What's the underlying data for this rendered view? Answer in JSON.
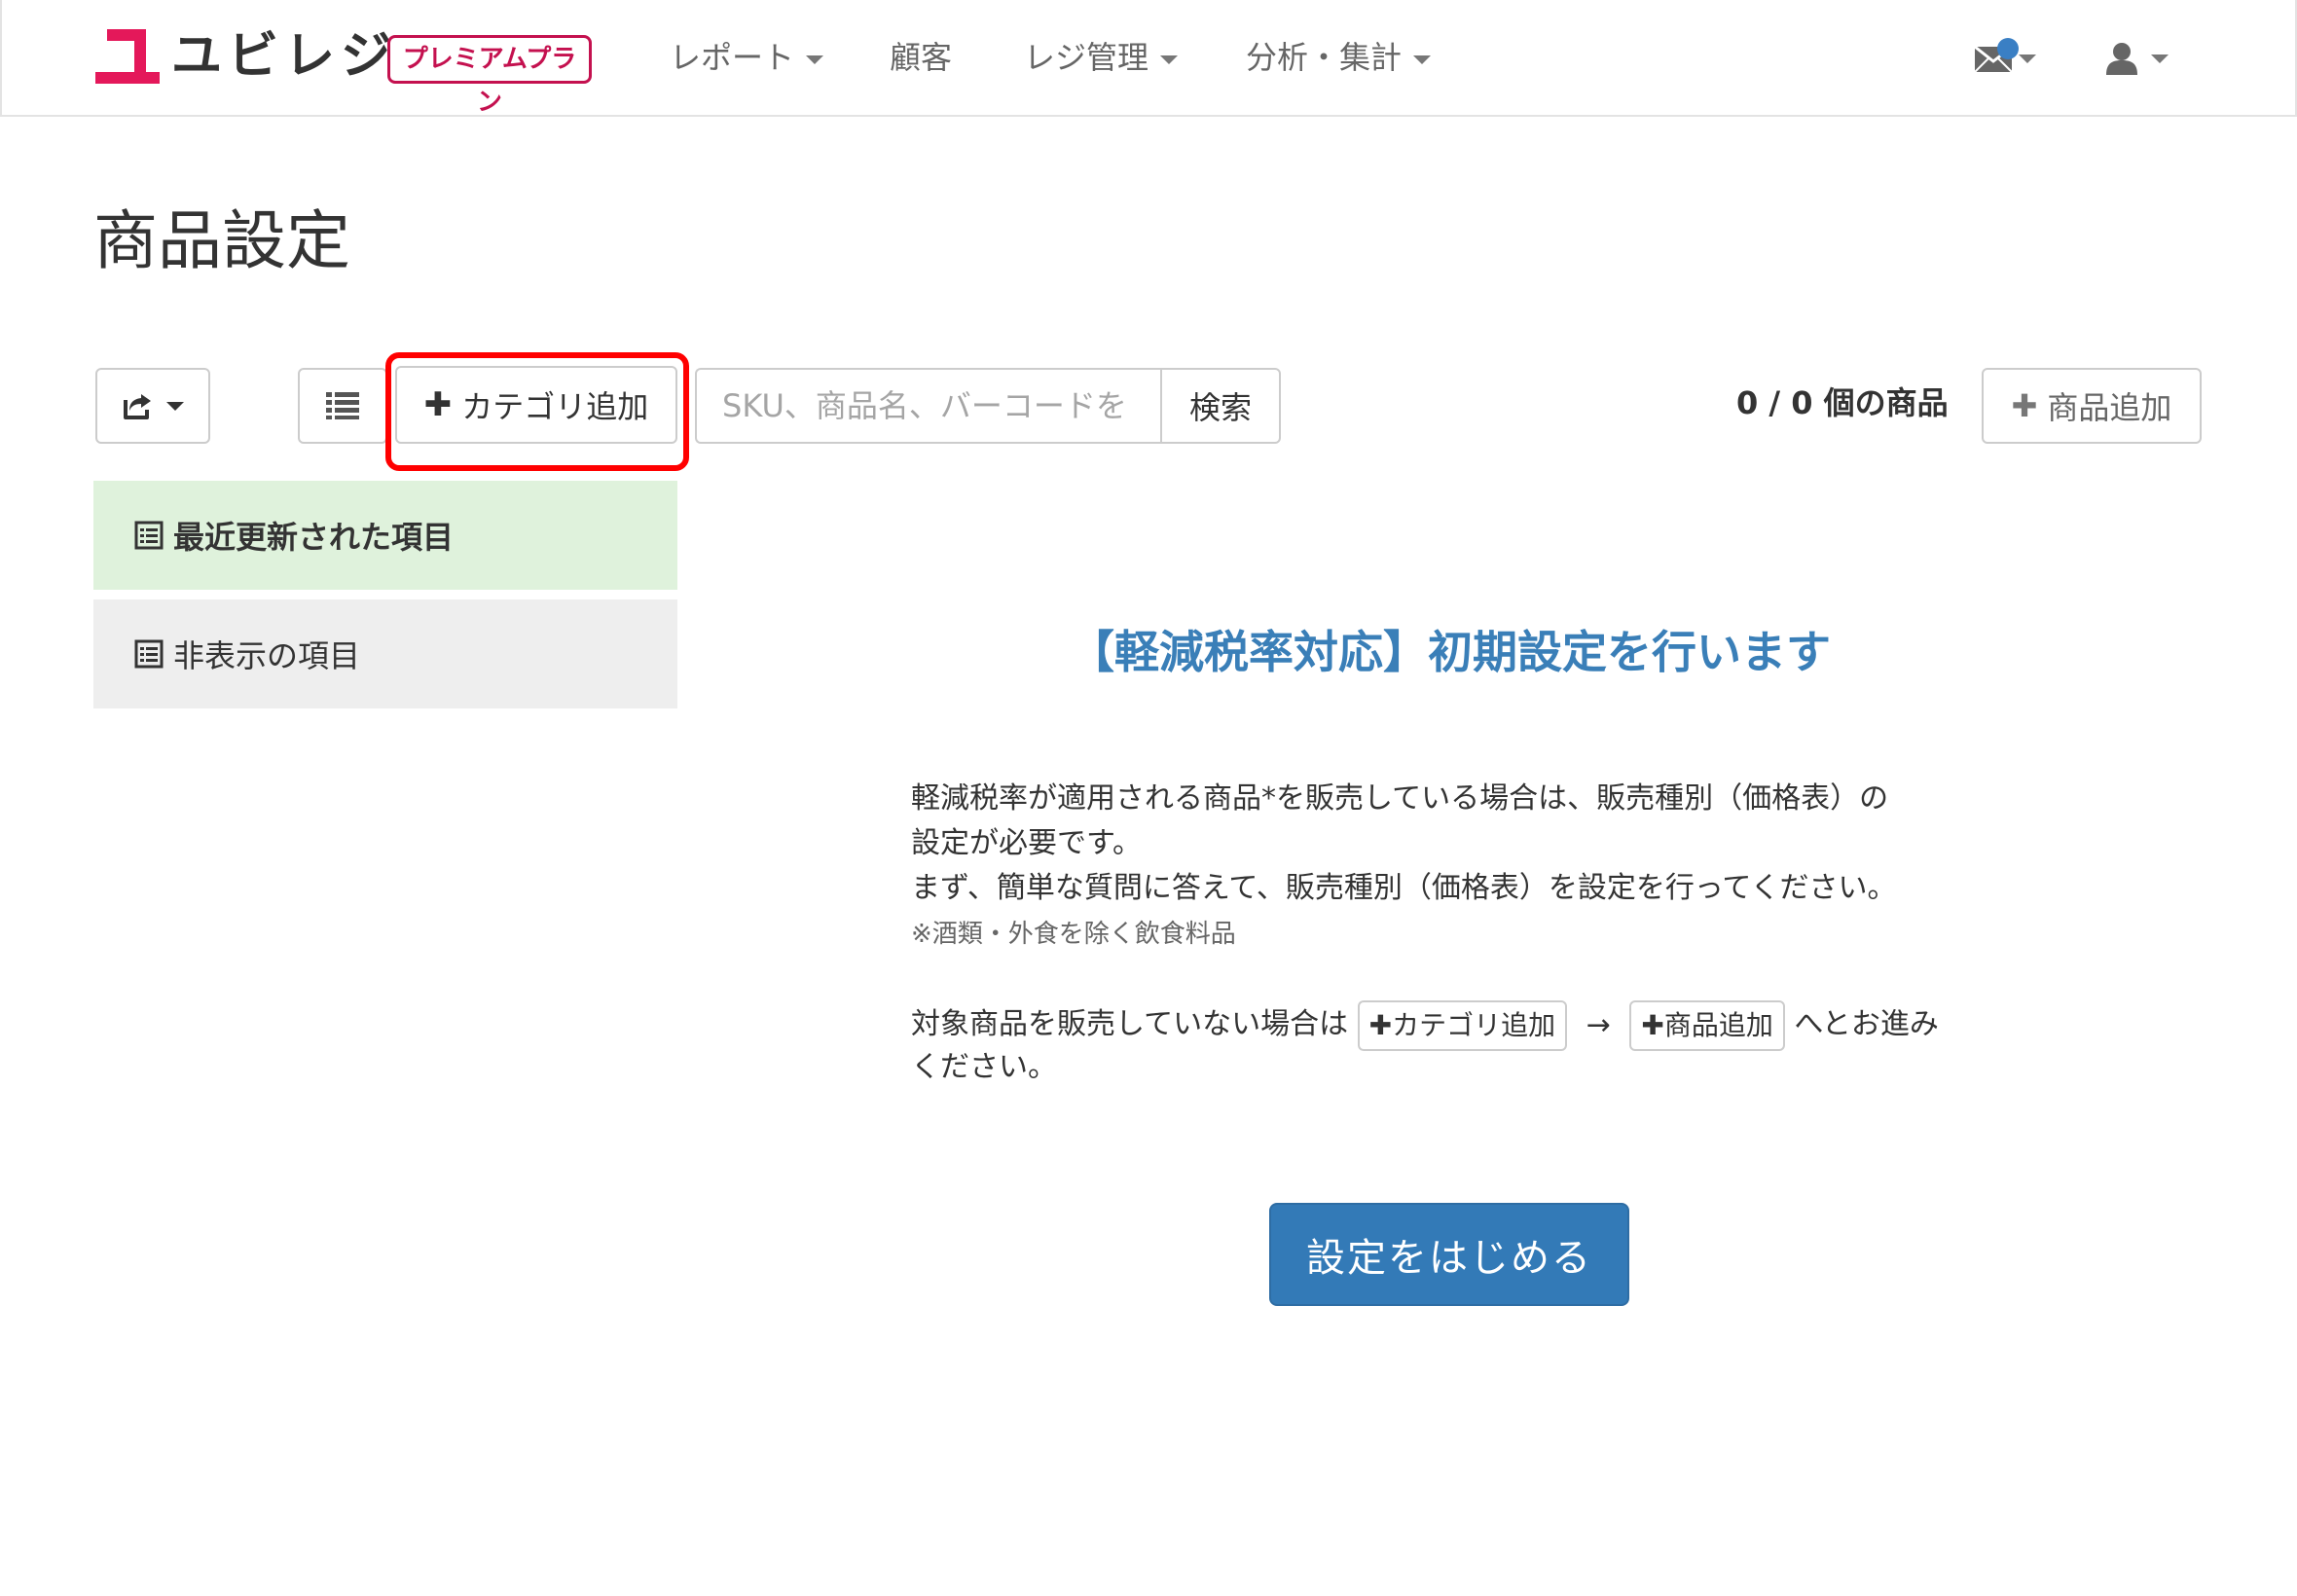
{
  "brand": {
    "name": "ユビレジ",
    "plan": "プレミアムプラン",
    "accent": "#e4185a"
  },
  "nav": {
    "items": [
      {
        "label": "レポート",
        "dropdown": true
      },
      {
        "label": "顧客",
        "dropdown": false
      },
      {
        "label": "レジ管理",
        "dropdown": true
      },
      {
        "label": "分析・集計",
        "dropdown": true
      }
    ],
    "icons": [
      "mail-icon",
      "user-icon"
    ]
  },
  "page": {
    "title": "商品設定"
  },
  "toolbar": {
    "category_add": "カテゴリ追加",
    "search_placeholder": "SKU、商品名、バーコードを",
    "search_button": "検索",
    "product_count": "0 / 0 個の商品",
    "product_add": "商品追加"
  },
  "sidebar": {
    "items": [
      {
        "label": "最近更新された項目",
        "active": true
      },
      {
        "label": "非表示の項目",
        "active": false
      }
    ]
  },
  "main": {
    "heading": "【軽減税率対応】初期設定を行います",
    "paragraph1_line1": "軽減税率が適用される商品*を販売している場合は、販売種別（価格表）の",
    "paragraph1_line2": "設定が必要です。",
    "paragraph1_line3": "まず、簡単な質問に答えて、販売種別（価格表）を設定を行ってください。",
    "note": "※酒類・外食を除く飲食料品",
    "paragraph2_prefix": "対象商品を販売していない場合は",
    "inline_category": "カテゴリ追加",
    "arrow": "→",
    "inline_product": "商品追加",
    "paragraph2_suffix": "へとお進み",
    "paragraph2_line2": "ください。",
    "start_button": "設定をはじめる"
  }
}
